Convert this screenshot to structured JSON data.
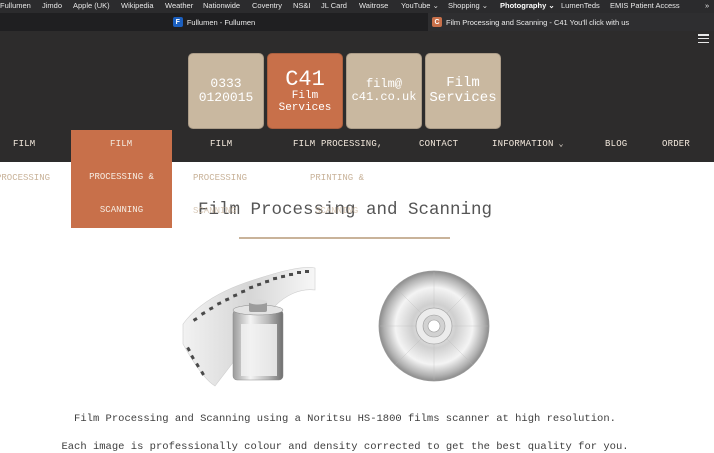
{
  "bookmarks": [
    "Fullumen",
    "Jimdo",
    "Apple (UK)",
    "Wikipedia",
    "Weather",
    "Nationwide",
    "Coventry",
    "NS&I",
    "JL Card",
    "Waitrose",
    "YouTube",
    "Shopping",
    "Photography",
    "LumenTeds",
    "EMIS Patient Access"
  ],
  "bookmarks_overflow": "»",
  "tabs": [
    {
      "title": "Fullumen - Fullumen",
      "favicon": "F"
    },
    {
      "title": "Film Processing and Scanning - C41 You'll click with us",
      "favicon": "C"
    }
  ],
  "header": {
    "phone_line1": "0333",
    "phone_line2": "0120015",
    "logo_line1": "C41",
    "logo_line2": "Film",
    "logo_line3": "Services",
    "email_line1": "film@",
    "email_line2": "c41.co.uk",
    "services_line1": "Film",
    "services_line2": "Services"
  },
  "nav": {
    "film": "FILM",
    "film_active": "FILM",
    "film2": "FILM",
    "film_processing": "FILM PROCESSING,",
    "contact": "CONTACT",
    "information": "INFORMATION",
    "blog": "BLOG",
    "order": "ORDER"
  },
  "dropdown": {
    "line1": "PROCESSING &",
    "line2": "SCANNING"
  },
  "subtexts": {
    "processing_left": "PROCESSING",
    "processing_mid": "PROCESSING",
    "printing": "PRINTING &",
    "ghost1": "SCANNING",
    "ghost2": "SCANNING"
  },
  "page": {
    "title": "Film Processing and Scanning",
    "line1": "Film Processing and Scanning using a Noritsu HS-1800 films scanner at high resolution.",
    "line2": "Each image is professionally colour and density corrected to get the best quality for you."
  },
  "colors": {
    "header_bg": "#2d2c2c",
    "accent_orange": "#c8704a",
    "tile_beige": "#c9b8a0",
    "nav_text": "#f2e8dc"
  },
  "icons": {
    "menu": "hamburger-icon",
    "chevron": "chevron-down-icon"
  }
}
